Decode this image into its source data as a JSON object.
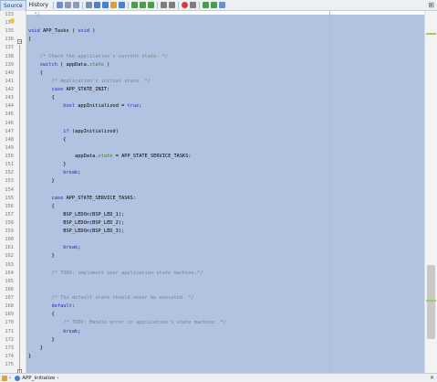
{
  "toolbar": {
    "tabs": [
      "Source",
      "History"
    ],
    "expand_label": "⊞"
  },
  "gutter": {
    "line_numbers": [
      "133",
      "134",
      "135",
      "136",
      "137",
      "138",
      "139",
      "140",
      "141",
      "142",
      "143",
      "144",
      "145",
      "146",
      "147",
      "148",
      "149",
      "150",
      "151",
      "152",
      "153",
      "154",
      "155",
      "156",
      "157",
      "158",
      "159",
      "160",
      "161",
      "162",
      "163",
      "164",
      "165",
      "166",
      "167",
      "168",
      "169",
      "170",
      "171",
      "172",
      "173",
      "174",
      "175"
    ]
  },
  "code": {
    "lines": [
      "  */",
      "",
      "void APP_Tasks ( void )",
      "{",
      "",
      "    /* Check the application's current state. */",
      "    switch ( appData.state )",
      "    {",
      "        /* Application's initial state. */",
      "        case APP_STATE_INIT:",
      "        {",
      "            bool appInitialized = true;",
      "",
      "",
      "            if (appInitialized)",
      "            {",
      "",
      "                appData.state = APP_STATE_SERVICE_TASKS;",
      "            }",
      "            break;",
      "        }",
      "",
      "        case APP_STATE_SERVICE_TASKS:",
      "        {",
      "            BSP_LEDOn(BSP_LED_1);",
      "            BSP_LEDOn(BSP_LED_2);",
      "            BSP_LEDOn(BSP_LED_3);",
      "",
      "            break;",
      "        }",
      "",
      "        /* TODO: implement your application state machine.*/",
      "",
      "",
      "        /* The default state should never be executed. */",
      "        default:",
      "        {",
      "            /* TODO: Handle error in application's state machine. */",
      "            break;",
      "        }",
      "    }",
      "}",
      ""
    ]
  },
  "status_bar": {
    "breadcrumb": [
      "APP_Initialize"
    ],
    "close_label": "✕"
  }
}
